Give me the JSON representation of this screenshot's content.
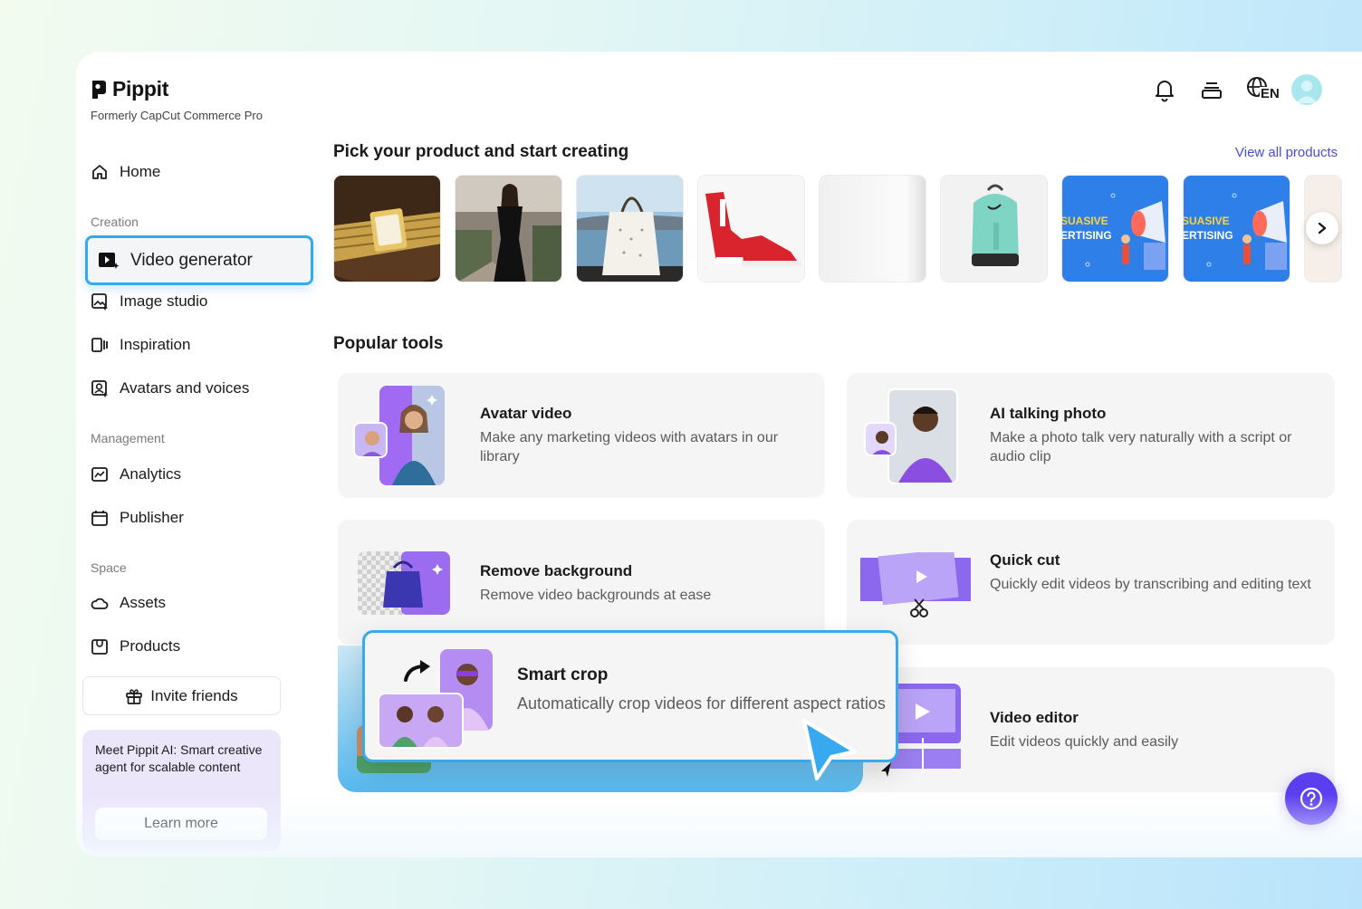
{
  "brand": {
    "name": "Pippit",
    "subtitle": "Formerly CapCut Commerce Pro"
  },
  "header": {
    "language_code": "EN",
    "icons": [
      "bell-icon",
      "stack-icon",
      "globe-icon",
      "avatar"
    ]
  },
  "sidebar": {
    "home": "Home",
    "sections": {
      "creation": "Creation",
      "management": "Management",
      "space": "Space"
    },
    "items": {
      "video_generator": "Video generator",
      "image_studio": "Image studio",
      "inspiration": "Inspiration",
      "avatars_voices": "Avatars and voices",
      "analytics": "Analytics",
      "publisher": "Publisher",
      "assets": "Assets",
      "products": "Products"
    },
    "invite": "Invite friends",
    "promo": {
      "text": "Meet Pippit AI: Smart creative agent for scalable content",
      "button": "Learn more"
    }
  },
  "main": {
    "products_heading": "Pick your product and start creating",
    "view_all": "View all products",
    "product_images": [
      "watch",
      "black-dress",
      "tote-bag",
      "red-sneakers",
      "blank-product",
      "teal-backpack",
      "advertising-poster",
      "advertising-poster",
      "partial-item"
    ],
    "poster_text_1": "SUASIVE",
    "poster_text_2": "ERTISING",
    "tools_heading": "Popular tools",
    "tools": [
      {
        "title": "Avatar video",
        "desc": "Make any marketing videos with avatars in our library"
      },
      {
        "title": "AI talking photo",
        "desc": "Make a photo talk very naturally with a script or audio clip"
      },
      {
        "title": "Remove background",
        "desc": "Remove video backgrounds at ease"
      },
      {
        "title": "Quick cut",
        "desc": "Quickly edit videos by transcribing and editing text"
      },
      {
        "title": "Smart crop",
        "desc": "Automatically crop videos for different aspect ratios"
      },
      {
        "title": "Video editor",
        "desc": "Edit videos quickly and easily"
      }
    ]
  },
  "colors": {
    "accent_blue": "#39a9ef",
    "link_purple": "#4b4bd6",
    "help_purple": "#5b3ef0",
    "promo_bg": "#ece6fb"
  }
}
